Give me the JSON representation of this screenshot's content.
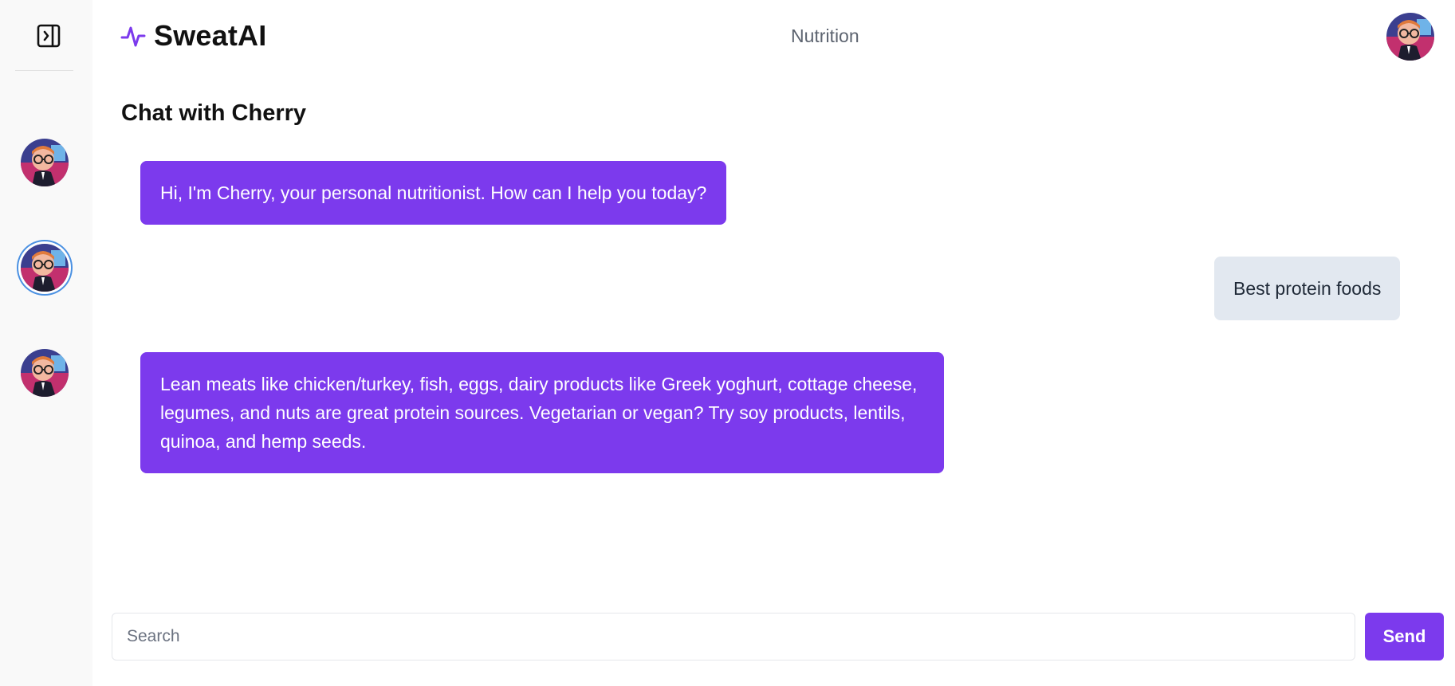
{
  "app": {
    "name": "SweatAI",
    "logo_icon": "activity-pulse-icon",
    "accent_color": "#7c3aed"
  },
  "header": {
    "nav_title": "Nutrition",
    "user_avatar_icon": "user-avatar"
  },
  "sidebar": {
    "toggle_icon": "sidebar-expand-icon",
    "avatars": [
      {
        "name": "coach-avatar",
        "active": false
      },
      {
        "name": "coach-avatar",
        "active": true
      },
      {
        "name": "coach-avatar",
        "active": false
      }
    ]
  },
  "page": {
    "title": "Chat with Cherry"
  },
  "chat": {
    "messages": [
      {
        "role": "assistant",
        "text": "Hi, I'm Cherry, your personal nutritionist. How can I help you today?"
      },
      {
        "role": "user",
        "text": "Best protein foods"
      },
      {
        "role": "assistant",
        "text": "Lean meats like chicken/turkey, fish, eggs, dairy products like Greek yoghurt, cottage cheese, legumes, and nuts are great protein sources. Vegetarian or vegan? Try soy products, lentils, quinoa, and hemp seeds."
      }
    ]
  },
  "composer": {
    "placeholder": "Search",
    "value": "",
    "send_label": "Send"
  }
}
